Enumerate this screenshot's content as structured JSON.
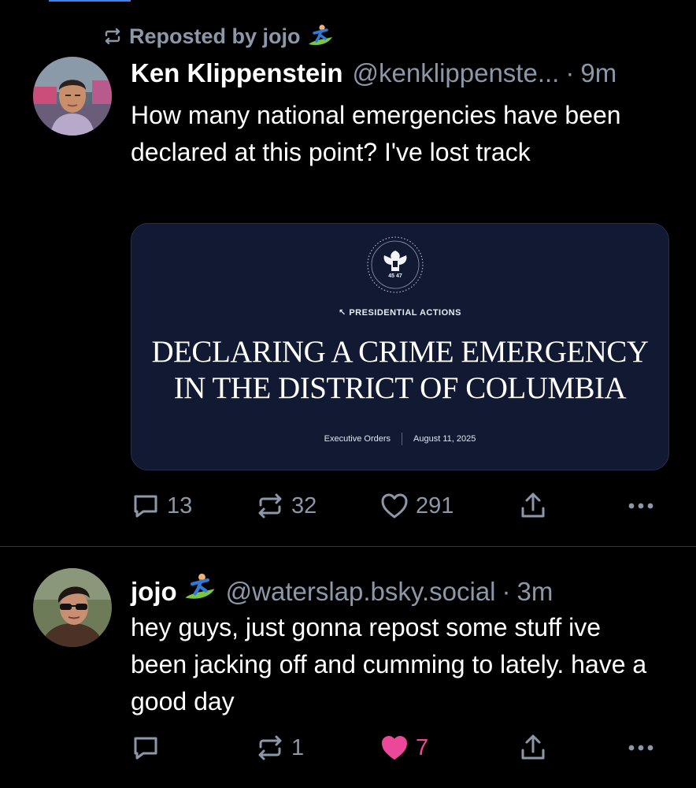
{
  "feed": {
    "colors": {
      "background": "#000000",
      "muted": "#8b98a9",
      "like_active": "#ec4899",
      "embed_bg": "#121a33",
      "accent": "#3b82f6"
    },
    "posts": [
      {
        "repost_label": "Reposted by jojo",
        "repost_icon": "repost-icon",
        "repost_emoji": "surfer-emoji",
        "author": {
          "display_name": "Ken Klippenstein",
          "handle": "@kenklippenste...",
          "timestamp": "9m"
        },
        "text": "How many national emergencies have been declared at this point? I've lost track",
        "embed": {
          "seal_numbers": "45 47",
          "kicker": "↖ PRESIDENTIAL ACTIONS",
          "title_line1": "DECLARING A CRIME EMERGENCY",
          "title_line2": "IN THE DISTRICT OF COLUMBIA",
          "category": "Executive Orders",
          "date": "August 11, 2025"
        },
        "counts": {
          "replies": "13",
          "reposts": "32",
          "likes": "291"
        }
      },
      {
        "author": {
          "display_name": "jojo",
          "emoji": "surfer-emoji",
          "handle": "@waterslap.bsky.social",
          "timestamp": "3m"
        },
        "text": "hey guys, just gonna repost some stuff ive been jacking off and cumming to lately. have a good day",
        "counts": {
          "replies": "",
          "reposts": "1",
          "likes": "7",
          "liked": true
        }
      }
    ]
  }
}
